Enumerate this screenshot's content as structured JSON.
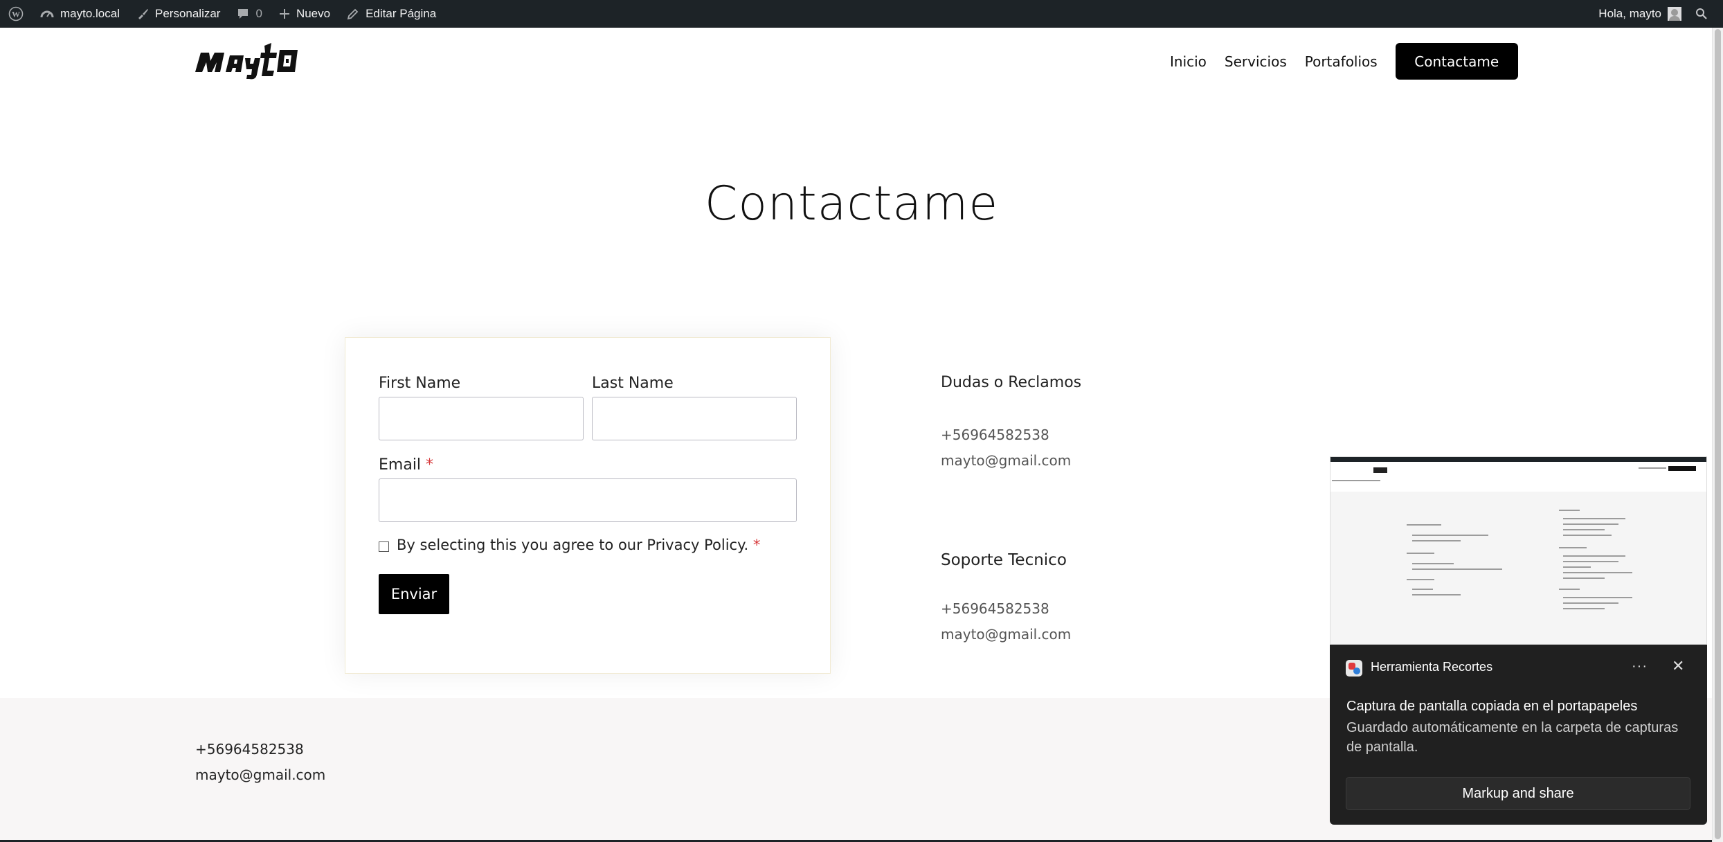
{
  "admin_bar": {
    "site_name": "mayto.local",
    "customize": "Personalizar",
    "comments_count": "0",
    "new": "Nuevo",
    "edit_page": "Editar Página",
    "greeting": "Hola, mayto"
  },
  "header": {
    "logo_text": "mayto",
    "nav": [
      "Inicio",
      "Servicios",
      "Portafolios"
    ],
    "cta": "Contactame"
  },
  "page": {
    "title": "Contactame"
  },
  "form": {
    "first_name_label": "First Name",
    "last_name_label": "Last Name",
    "email_label": "Email",
    "required_mark": "*",
    "privacy_label": "By selecting this you agree to our Privacy Policy.",
    "submit": "Enviar"
  },
  "contact_blocks": [
    {
      "heading": "Dudas o Reclamos",
      "phone": "+56964582538",
      "email": "mayto@gmail.com"
    },
    {
      "heading": "Soporte Tecnico",
      "phone": "+56964582538",
      "email": "mayto@gmail.com"
    }
  ],
  "footer": {
    "phone": "+56964582538",
    "email": "mayto@gmail.com"
  },
  "toast": {
    "app_name": "Herramienta Recortes",
    "more": "···",
    "title": "Captura de pantalla copiada en el portapapeles",
    "body": "Guardado automáticamente en la carpeta de capturas de pantalla.",
    "button": "Markup and share"
  },
  "colors": {
    "admin_bar": "#1d2327",
    "accent": "#000000",
    "toast_bg": "#202020",
    "required": "#d63638"
  }
}
